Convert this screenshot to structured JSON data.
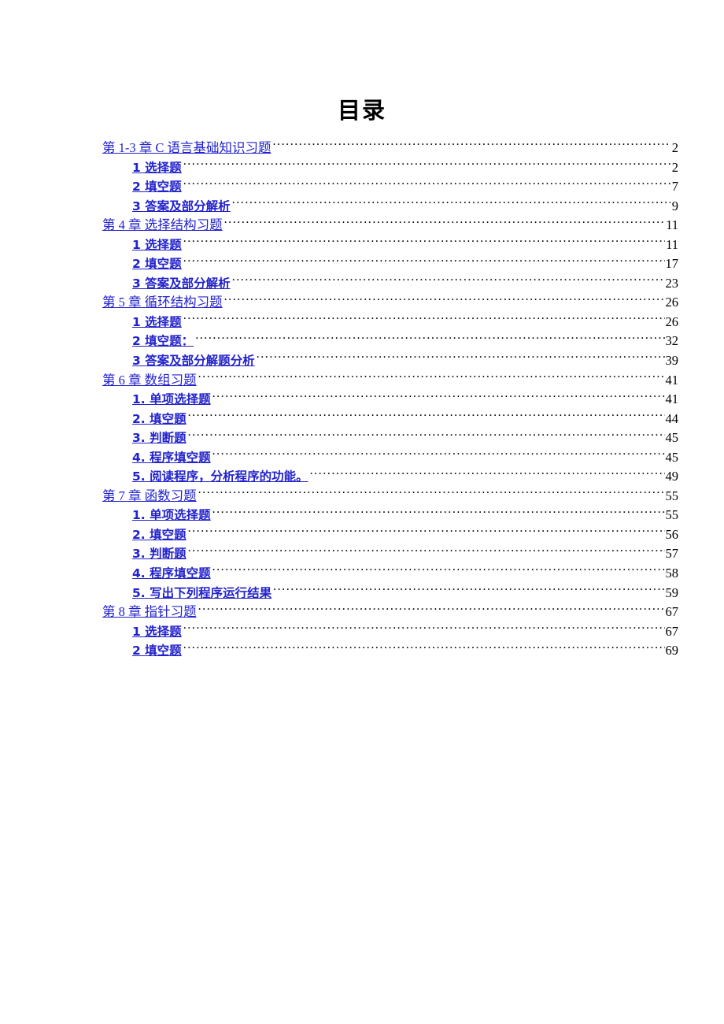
{
  "document": {
    "title": "目录",
    "link_color": "#2222CC",
    "text_color": "#000000",
    "background_color": "#FFFFFF"
  },
  "toc": {
    "entries": [
      {
        "level": 1,
        "label": "第 1-3 章  C 语言基础知识习题",
        "page": "2"
      },
      {
        "level": 2,
        "label": "1 选择题",
        "page": "2"
      },
      {
        "level": 2,
        "label": "2 填空题",
        "page": "7"
      },
      {
        "level": 2,
        "label": "3 答案及部分解析",
        "page": "9"
      },
      {
        "level": 1,
        "label": "第 4 章  选择结构习题",
        "page": "11"
      },
      {
        "level": 2,
        "label": "1 选择题",
        "page": "11"
      },
      {
        "level": 2,
        "label": "2 填空题",
        "page": "17"
      },
      {
        "level": 2,
        "label": "3 答案及部分解析",
        "page": "23"
      },
      {
        "level": 1,
        "label": "第 5 章  循环结构习题",
        "page": "26"
      },
      {
        "level": 2,
        "label": "1 选择题",
        "page": "26"
      },
      {
        "level": 2,
        "label": "2 填空题：",
        "page": "32"
      },
      {
        "level": 2,
        "label": "3 答案及部分解题分析",
        "page": "39"
      },
      {
        "level": 1,
        "label": "第 6 章  数组习题",
        "page": "41"
      },
      {
        "level": 2,
        "label": "1. 单项选择题",
        "page": "41"
      },
      {
        "level": 2,
        "label": "2. 填空题",
        "page": "44"
      },
      {
        "level": 2,
        "label": "3. 判断题",
        "page": "45"
      },
      {
        "level": 2,
        "label": "4. 程序填空题",
        "page": "45"
      },
      {
        "level": 2,
        "label": "5. 阅读程序，分析程序的功能。",
        "page": "49"
      },
      {
        "level": 1,
        "label": "第 7 章  函数习题",
        "page": "55"
      },
      {
        "level": 2,
        "label": "1. 单项选择题",
        "page": "55"
      },
      {
        "level": 2,
        "label": "2. 填空题",
        "page": "56"
      },
      {
        "level": 2,
        "label": "3. 判断题",
        "page": "57"
      },
      {
        "level": 2,
        "label": "4. 程序填空题",
        "page": "58"
      },
      {
        "level": 2,
        "label": "5. 写出下列程序运行结果",
        "page": "59"
      },
      {
        "level": 1,
        "label": "第 8 章  指针习题",
        "page": "67"
      },
      {
        "level": 2,
        "label": "1 选择题",
        "page": "67"
      },
      {
        "level": 2,
        "label": "2 填空题",
        "page": "69"
      }
    ]
  }
}
